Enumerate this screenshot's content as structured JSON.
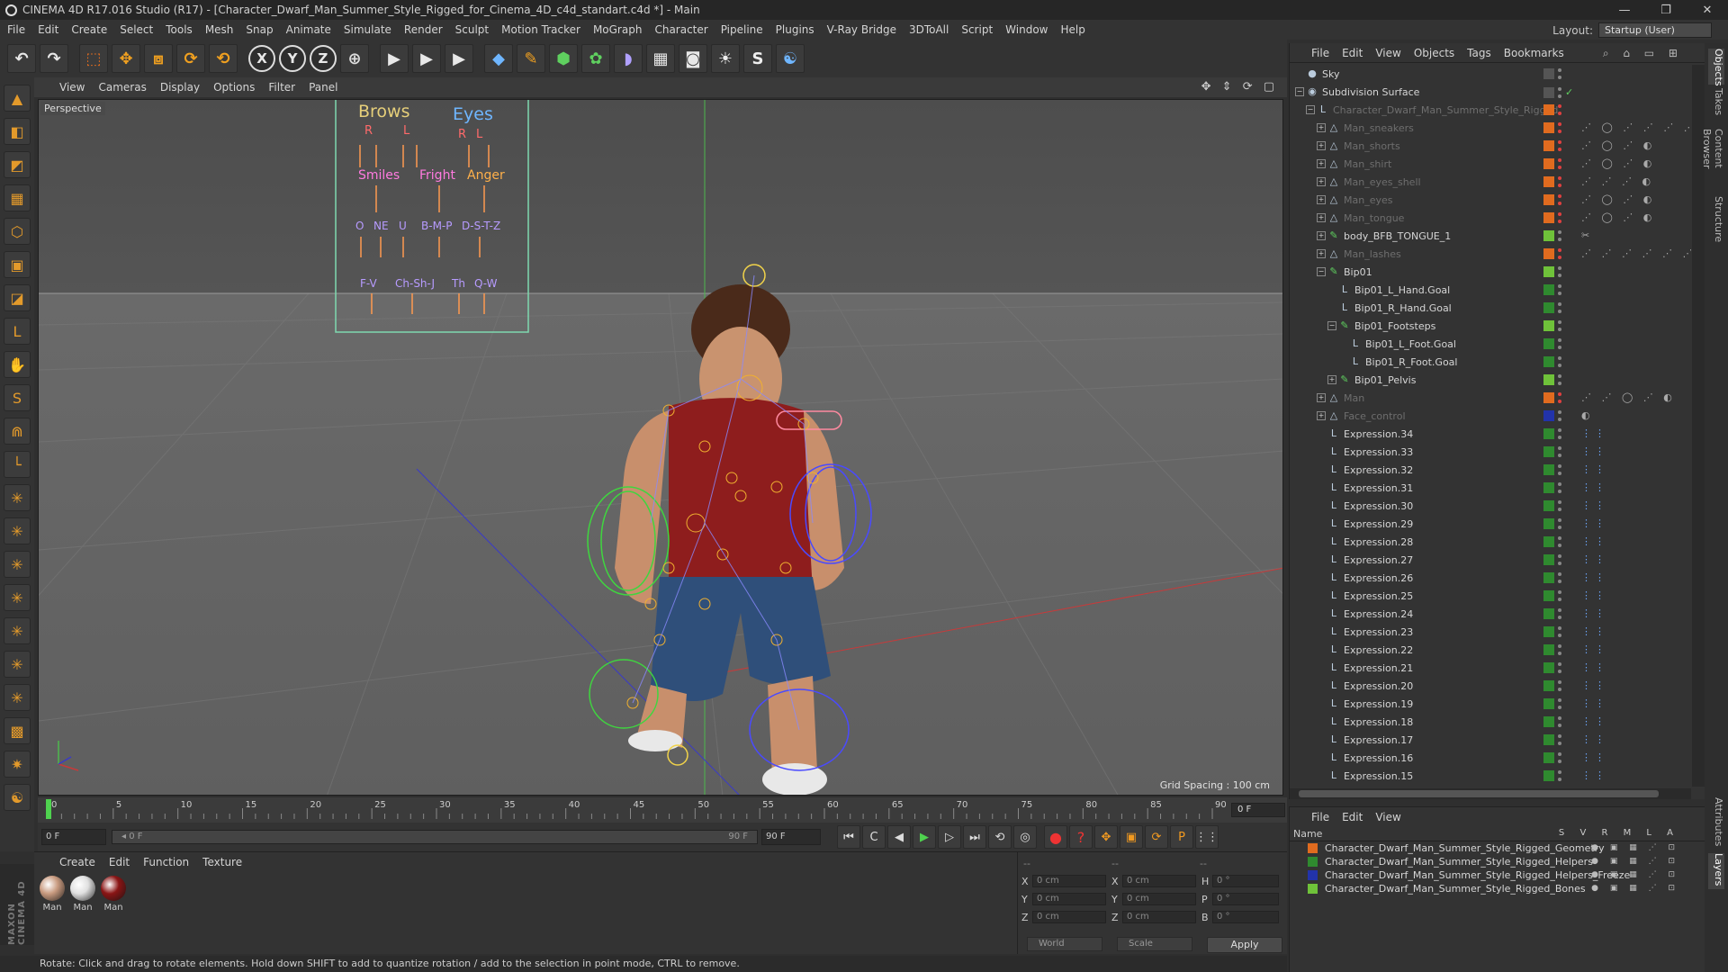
{
  "window": {
    "title": "CINEMA 4D R17.016 Studio (R17) - [Character_Dwarf_Man_Summer_Style_Rigged_for_Cinema_4D_c4d_standart.c4d *] - Main",
    "controls": [
      "—",
      "❐",
      "✕"
    ]
  },
  "menubar": {
    "items": [
      "File",
      "Edit",
      "Create",
      "Select",
      "Tools",
      "Mesh",
      "Snap",
      "Animate",
      "Simulate",
      "Render",
      "Sculpt",
      "Motion Tracker",
      "MoGraph",
      "Character",
      "Pipeline",
      "Plugins",
      "V-Ray Bridge",
      "3DToAll",
      "Script",
      "Window",
      "Help"
    ],
    "layout_label": "Layout:",
    "layout_value": "Startup (User)"
  },
  "toolbar": {
    "buttons": [
      {
        "name": "undo",
        "glyph": "↶"
      },
      {
        "name": "redo",
        "glyph": "↷"
      },
      {
        "name": "live-selection",
        "glyph": "⬚"
      },
      {
        "name": "move",
        "glyph": "✥"
      },
      {
        "name": "scale",
        "glyph": "⧈"
      },
      {
        "name": "rotate",
        "glyph": "⟳"
      },
      {
        "name": "recent-tool",
        "glyph": "⟲"
      },
      {
        "name": "x-axis",
        "glyph": "X"
      },
      {
        "name": "y-axis",
        "glyph": "Y"
      },
      {
        "name": "z-axis",
        "glyph": "Z"
      },
      {
        "name": "world-coordinates",
        "glyph": "⊕"
      },
      {
        "name": "render-view",
        "glyph": "▶"
      },
      {
        "name": "render-picture-viewer",
        "glyph": "▶"
      },
      {
        "name": "edit-render-settings",
        "glyph": "▶"
      },
      {
        "name": "cube",
        "glyph": "◆"
      },
      {
        "name": "pen",
        "glyph": "✎"
      },
      {
        "name": "subdivision",
        "glyph": "⬢"
      },
      {
        "name": "array",
        "glyph": "✿"
      },
      {
        "name": "deformer",
        "glyph": "◗"
      },
      {
        "name": "floor",
        "glyph": "▦"
      },
      {
        "name": "camera",
        "glyph": "◙"
      },
      {
        "name": "light",
        "glyph": "☀"
      },
      {
        "name": "sketch",
        "glyph": "S"
      },
      {
        "name": "python",
        "glyph": "☯"
      }
    ]
  },
  "left_tools": [
    "▲",
    "◧",
    "◩",
    "▦",
    "⬡",
    "▣",
    "◪",
    "L",
    "✋",
    "S",
    "⋒",
    "└",
    "✳",
    "✳",
    "✳",
    "✳",
    "✳",
    "✳",
    "✳",
    "▩",
    "✷",
    "☯"
  ],
  "maxon_logo": "MAXON CINEMA 4D",
  "viewport": {
    "menu": [
      "View",
      "Cameras",
      "Display",
      "Options",
      "Filter",
      "Panel"
    ],
    "nav_icons": "✥ ⇕ ⟳ ▢",
    "camera": "Perspective",
    "grid_spacing": "Grid Spacing : 100 cm",
    "face_panel": {
      "labels": [
        {
          "text": "Brows",
          "color": "#e6cf7a"
        },
        {
          "text": "Eyes",
          "color": "#6fb6ff"
        },
        {
          "text": "R",
          "color": "#ff6a6a"
        },
        {
          "text": "L",
          "color": "#ff6a6a"
        },
        {
          "text": "R",
          "color": "#ff6a6a"
        },
        {
          "text": "L",
          "color": "#ff6a6a"
        },
        {
          "text": "Smiles",
          "color": "#ff7adf"
        },
        {
          "text": "Fright",
          "color": "#ff7adf"
        },
        {
          "text": "Anger",
          "color": "#ffb04a"
        },
        {
          "text": "O",
          "color": "#b79bff"
        },
        {
          "text": "NE",
          "color": "#b79bff"
        },
        {
          "text": "U",
          "color": "#b79bff"
        },
        {
          "text": "B-M-P",
          "color": "#b79bff"
        },
        {
          "text": "D-S-T-Z",
          "color": "#b79bff"
        },
        {
          "text": "F-V",
          "color": "#b79bff"
        },
        {
          "text": "Ch-Sh-J",
          "color": "#b79bff"
        },
        {
          "text": "Th",
          "color": "#b79bff"
        },
        {
          "text": "Q-W",
          "color": "#b79bff"
        }
      ]
    }
  },
  "timeline": {
    "ticks": [
      "0",
      "5",
      "10",
      "15",
      "20",
      "25",
      "30",
      "35",
      "40",
      "45",
      "50",
      "55",
      "60",
      "65",
      "70",
      "75",
      "80",
      "85",
      "90"
    ],
    "current_frame": "0 F"
  },
  "transport": {
    "start_field": "0 F",
    "slider_left": "◂ 0 F",
    "slider_right": "90 F",
    "end_field": "90 F",
    "buttons": [
      "⏮",
      "C",
      "◀",
      "▶",
      "▷",
      "⏭",
      "⟲",
      "◎",
      "●",
      "?",
      "✥",
      "▣",
      "⟳",
      "P",
      "⋮⋮"
    ]
  },
  "material_manager": {
    "menu": [
      "Create",
      "Edit",
      "Function",
      "Texture"
    ],
    "materials": [
      {
        "name": "Man",
        "color": "#c99b80"
      },
      {
        "name": "Man",
        "color": "#e0e0e0"
      },
      {
        "name": "Man",
        "color": "#8a1515"
      }
    ]
  },
  "coordinates": {
    "header_left": "--",
    "header_mid": "--",
    "header_right": "--",
    "rows": [
      {
        "a": "X",
        "av": "0 cm",
        "b": "X",
        "bv": "0 cm",
        "c": "H",
        "cv": "0 °"
      },
      {
        "a": "Y",
        "av": "0 cm",
        "b": "Y",
        "bv": "0 cm",
        "c": "P",
        "cv": "0 °"
      },
      {
        "a": "Z",
        "av": "0 cm",
        "b": "Z",
        "bv": "0 cm",
        "c": "B",
        "cv": "0 °"
      }
    ],
    "mode": "World",
    "transform": "Scale",
    "apply": "Apply"
  },
  "status": "Rotate: Click and drag to rotate elements. Hold down SHIFT to add to quantize rotation / add to the selection in point mode, CTRL to remove.",
  "object_manager": {
    "menu": [
      "File",
      "Edit",
      "View",
      "Objects",
      "Tags",
      "Bookmarks"
    ],
    "icons": "⌕ ⌂ ▭ ⊞",
    "rows": [
      {
        "name": "Sky",
        "indent": 0,
        "exp": "",
        "icon": "●",
        "dim": false,
        "layer": "",
        "tags": "",
        "check": ""
      },
      {
        "name": "Subdivision Surface",
        "indent": 0,
        "exp": "−",
        "icon": "◉",
        "dim": false,
        "layer": "",
        "tags": "",
        "check": "✓"
      },
      {
        "name": "Character_Dwarf_Man_Summer_Style_Rigged",
        "indent": 1,
        "exp": "−",
        "icon": "L",
        "dim": true,
        "layer": "#e06b1f",
        "tags": "",
        "check": ""
      },
      {
        "name": "Man_sneakers",
        "indent": 2,
        "exp": "+",
        "icon": "△",
        "dim": true,
        "layer": "#e06b1f",
        "tags": "⋰ ◯ ⋰ ⋰ ⋰ ⋰",
        "check": ""
      },
      {
        "name": "Man_shorts",
        "indent": 2,
        "exp": "+",
        "icon": "△",
        "dim": true,
        "layer": "#e06b1f",
        "tags": "⋰ ◯ ⋰ ◐",
        "check": ""
      },
      {
        "name": "Man_shirt",
        "indent": 2,
        "exp": "+",
        "icon": "△",
        "dim": true,
        "layer": "#e06b1f",
        "tags": "⋰ ◯ ⋰ ◐",
        "check": ""
      },
      {
        "name": "Man_eyes_shell",
        "indent": 2,
        "exp": "+",
        "icon": "△",
        "dim": true,
        "layer": "#e06b1f",
        "tags": "⋰ ⋰ ⋰ ◐",
        "check": ""
      },
      {
        "name": "Man_eyes",
        "indent": 2,
        "exp": "+",
        "icon": "△",
        "dim": true,
        "layer": "#e06b1f",
        "tags": "⋰ ◯ ⋰ ◐",
        "check": ""
      },
      {
        "name": "Man_tongue",
        "indent": 2,
        "exp": "+",
        "icon": "△",
        "dim": true,
        "layer": "#e06b1f",
        "tags": "⋰ ◯ ⋰ ◐",
        "check": ""
      },
      {
        "name": "body_BFB_TONGUE_1",
        "indent": 2,
        "exp": "+",
        "icon": "✎",
        "dim": false,
        "layer": "#6fc23a",
        "tags": "✂",
        "check": ""
      },
      {
        "name": "Man_lashes",
        "indent": 2,
        "exp": "+",
        "icon": "△",
        "dim": true,
        "layer": "#e06b1f",
        "tags": "⋰ ⋰ ⋰ ⋰ ⋰ ⋰",
        "check": ""
      },
      {
        "name": "Bip01",
        "indent": 2,
        "exp": "−",
        "icon": "✎",
        "dim": false,
        "layer": "#6fc23a",
        "tags": "",
        "check": ""
      },
      {
        "name": "Bip01_L_Hand.Goal",
        "indent": 3,
        "exp": "",
        "icon": "L",
        "dim": false,
        "layer": "#2f8a2f",
        "tags": "",
        "check": ""
      },
      {
        "name": "Bip01_R_Hand.Goal",
        "indent": 3,
        "exp": "",
        "icon": "L",
        "dim": false,
        "layer": "#2f8a2f",
        "tags": "",
        "check": ""
      },
      {
        "name": "Bip01_Footsteps",
        "indent": 3,
        "exp": "−",
        "icon": "✎",
        "dim": false,
        "layer": "#6fc23a",
        "tags": "",
        "check": ""
      },
      {
        "name": "Bip01_L_Foot.Goal",
        "indent": 4,
        "exp": "",
        "icon": "L",
        "dim": false,
        "layer": "#2f8a2f",
        "tags": "",
        "check": ""
      },
      {
        "name": "Bip01_R_Foot.Goal",
        "indent": 4,
        "exp": "",
        "icon": "L",
        "dim": false,
        "layer": "#2f8a2f",
        "tags": "",
        "check": ""
      },
      {
        "name": "Bip01_Pelvis",
        "indent": 3,
        "exp": "+",
        "icon": "✎",
        "dim": false,
        "layer": "#6fc23a",
        "tags": "",
        "check": ""
      },
      {
        "name": "Man",
        "indent": 2,
        "exp": "+",
        "icon": "△",
        "dim": true,
        "layer": "#e06b1f",
        "tags": "⋰ ⋰ ◯ ⋰ ◐",
        "check": ""
      },
      {
        "name": "Face_control",
        "indent": 2,
        "exp": "+",
        "icon": "△",
        "dim": true,
        "layer": "#2233aa",
        "tags": "◐",
        "check": ""
      },
      {
        "name": "Expression.34",
        "indent": 2,
        "exp": "",
        "icon": "L",
        "dim": false,
        "layer": "#2f8a2f",
        "tags": "⋮⋮",
        "check": "",
        "blue": true
      },
      {
        "name": "Expression.33",
        "indent": 2,
        "exp": "",
        "icon": "L",
        "dim": false,
        "layer": "#2f8a2f",
        "tags": "⋮⋮",
        "check": "",
        "blue": true
      },
      {
        "name": "Expression.32",
        "indent": 2,
        "exp": "",
        "icon": "L",
        "dim": false,
        "layer": "#2f8a2f",
        "tags": "⋮⋮",
        "check": "",
        "blue": true
      },
      {
        "name": "Expression.31",
        "indent": 2,
        "exp": "",
        "icon": "L",
        "dim": false,
        "layer": "#2f8a2f",
        "tags": "⋮⋮",
        "check": "",
        "blue": true
      },
      {
        "name": "Expression.30",
        "indent": 2,
        "exp": "",
        "icon": "L",
        "dim": false,
        "layer": "#2f8a2f",
        "tags": "⋮⋮",
        "check": "",
        "blue": true
      },
      {
        "name": "Expression.29",
        "indent": 2,
        "exp": "",
        "icon": "L",
        "dim": false,
        "layer": "#2f8a2f",
        "tags": "⋮⋮",
        "check": "",
        "blue": true
      },
      {
        "name": "Expression.28",
        "indent": 2,
        "exp": "",
        "icon": "L",
        "dim": false,
        "layer": "#2f8a2f",
        "tags": "⋮⋮",
        "check": "",
        "blue": true
      },
      {
        "name": "Expression.27",
        "indent": 2,
        "exp": "",
        "icon": "L",
        "dim": false,
        "layer": "#2f8a2f",
        "tags": "⋮⋮",
        "check": "",
        "blue": true
      },
      {
        "name": "Expression.26",
        "indent": 2,
        "exp": "",
        "icon": "L",
        "dim": false,
        "layer": "#2f8a2f",
        "tags": "⋮⋮",
        "check": "",
        "blue": true
      },
      {
        "name": "Expression.25",
        "indent": 2,
        "exp": "",
        "icon": "L",
        "dim": false,
        "layer": "#2f8a2f",
        "tags": "⋮⋮",
        "check": "",
        "blue": true
      },
      {
        "name": "Expression.24",
        "indent": 2,
        "exp": "",
        "icon": "L",
        "dim": false,
        "layer": "#2f8a2f",
        "tags": "⋮⋮",
        "check": "",
        "blue": true
      },
      {
        "name": "Expression.23",
        "indent": 2,
        "exp": "",
        "icon": "L",
        "dim": false,
        "layer": "#2f8a2f",
        "tags": "⋮⋮",
        "check": "",
        "blue": true
      },
      {
        "name": "Expression.22",
        "indent": 2,
        "exp": "",
        "icon": "L",
        "dim": false,
        "layer": "#2f8a2f",
        "tags": "⋮⋮",
        "check": "",
        "blue": true
      },
      {
        "name": "Expression.21",
        "indent": 2,
        "exp": "",
        "icon": "L",
        "dim": false,
        "layer": "#2f8a2f",
        "tags": "⋮⋮",
        "check": "",
        "blue": true
      },
      {
        "name": "Expression.20",
        "indent": 2,
        "exp": "",
        "icon": "L",
        "dim": false,
        "layer": "#2f8a2f",
        "tags": "⋮⋮",
        "check": "",
        "blue": true
      },
      {
        "name": "Expression.19",
        "indent": 2,
        "exp": "",
        "icon": "L",
        "dim": false,
        "layer": "#2f8a2f",
        "tags": "⋮⋮",
        "check": "",
        "blue": true
      },
      {
        "name": "Expression.18",
        "indent": 2,
        "exp": "",
        "icon": "L",
        "dim": false,
        "layer": "#2f8a2f",
        "tags": "⋮⋮",
        "check": "",
        "blue": true
      },
      {
        "name": "Expression.17",
        "indent": 2,
        "exp": "",
        "icon": "L",
        "dim": false,
        "layer": "#2f8a2f",
        "tags": "⋮⋮",
        "check": "",
        "blue": true
      },
      {
        "name": "Expression.16",
        "indent": 2,
        "exp": "",
        "icon": "L",
        "dim": false,
        "layer": "#2f8a2f",
        "tags": "⋮⋮",
        "check": "",
        "blue": true
      },
      {
        "name": "Expression.15",
        "indent": 2,
        "exp": "",
        "icon": "L",
        "dim": false,
        "layer": "#2f8a2f",
        "tags": "⋮⋮",
        "check": "",
        "blue": true
      }
    ]
  },
  "layers_manager": {
    "menu": [
      "File",
      "Edit",
      "View"
    ],
    "header_name": "Name",
    "header_cols": "S V R M L A",
    "rows": [
      {
        "name": "Character_Dwarf_Man_Summer_Style_Rigged_Geometry",
        "color": "#e06b1f"
      },
      {
        "name": "Character_Dwarf_Man_Summer_Style_Rigged_Helpers",
        "color": "#2f8a2f"
      },
      {
        "name": "Character_Dwarf_Man_Summer_Style_Rigged_Helpers_Freeze",
        "color": "#2233aa"
      },
      {
        "name": "Character_Dwarf_Man_Summer_Style_Rigged_Bones",
        "color": "#6fc23a"
      }
    ],
    "row_icons": "● ▣ ▦ ⋰ ⊡"
  },
  "side_tabs": [
    "Objects",
    "Takes",
    "Content Browser",
    "Structure",
    "Attributes",
    "Layers"
  ]
}
